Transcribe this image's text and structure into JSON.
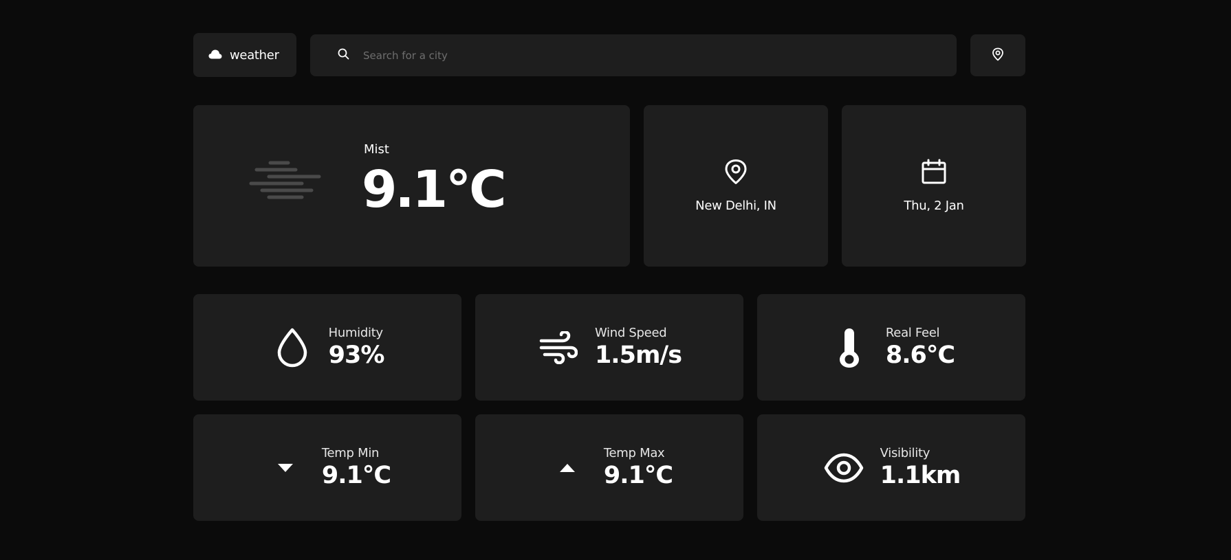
{
  "header": {
    "logo_text": "weather",
    "search_placeholder": "Search for a city"
  },
  "current": {
    "condition": "Mist",
    "temperature": "9.1°C",
    "location": "New Delhi, IN",
    "date": "Thu, 2 Jan"
  },
  "stats": {
    "humidity": {
      "label": "Humidity",
      "value": "93%"
    },
    "wind": {
      "label": "Wind Speed",
      "value": "1.5m/s"
    },
    "real_feel": {
      "label": "Real Feel",
      "value": "8.6°C"
    },
    "temp_min": {
      "label": "Temp Min",
      "value": "9.1°C"
    },
    "temp_max": {
      "label": "Temp Max",
      "value": "9.1°C"
    },
    "visibility": {
      "label": "Visibility",
      "value": "1.1km"
    }
  },
  "colors": {
    "background": "#0b0b0b",
    "card": "#1e1e1e",
    "text": "#ffffff",
    "placeholder": "#6e6e6e",
    "mist_icon": "#4a4a4a"
  },
  "icons": [
    "cloud-icon",
    "search-icon",
    "location-pin-icon",
    "mist-icon",
    "calendar-icon",
    "droplet-icon",
    "wind-icon",
    "thermometer-icon",
    "arrow-down-icon",
    "arrow-up-icon",
    "eye-icon"
  ]
}
